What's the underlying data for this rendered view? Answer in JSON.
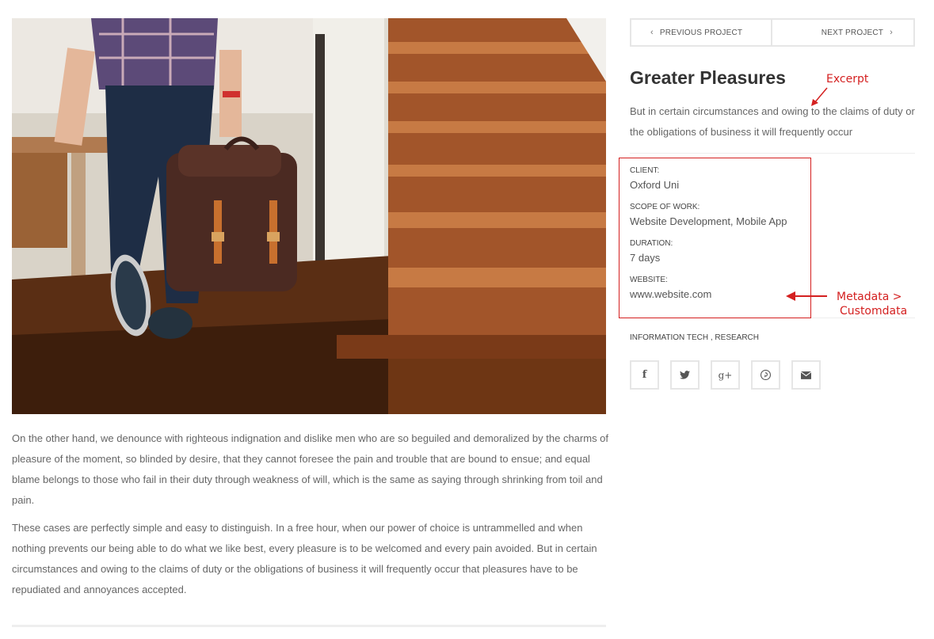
{
  "nav": {
    "prev_label": "PREVIOUS PROJECT",
    "next_label": "NEXT PROJECT"
  },
  "project": {
    "title": "Greater Pleasures",
    "excerpt": "But in certain circumstances and owing to the claims of duty or the obligations of business it will frequently occur"
  },
  "meta": [
    {
      "label": "CLIENT:",
      "value": "Oxford Uni"
    },
    {
      "label": "SCOPE OF WORK:",
      "value": "Website Development, Mobile App"
    },
    {
      "label": "DURATION:",
      "value": "7 days"
    },
    {
      "label": "WEBSITE:",
      "value": "www.website.com"
    }
  ],
  "categories": {
    "first": "INFORMATION TECH",
    "separator": " , ",
    "second": "RESEARCH"
  },
  "share_icons": [
    "facebook-icon",
    "twitter-icon",
    "google-plus-icon",
    "pinterest-icon",
    "email-icon"
  ],
  "content": {
    "paragraph_1": "On the other hand, we denounce with righteous indignation and dislike men who are so beguiled and demoralized by the charms of pleasure of the moment, so blinded by desire, that they cannot foresee the pain and trouble that are bound to ensue; and equal blame belongs to those who fail in their duty through weakness of will, which is the same as saying through shrinking from toil and pain.",
    "paragraph_2": "These cases are perfectly simple and easy to distinguish. In a free hour, when our power of choice is untrammelled and when nothing prevents our being able to do what we like best, every pleasure is to be welcomed and every pain avoided. But in certain circumstances and owing to the claims of duty or the obligations of business it will frequently occur that pleasures have to be repudiated and annoyances accepted."
  },
  "annotations": {
    "excerpt_label": "Excerpt",
    "metadata_line1": "Metadata >",
    "metadata_line2": "Customdata",
    "color": "#d42020"
  }
}
